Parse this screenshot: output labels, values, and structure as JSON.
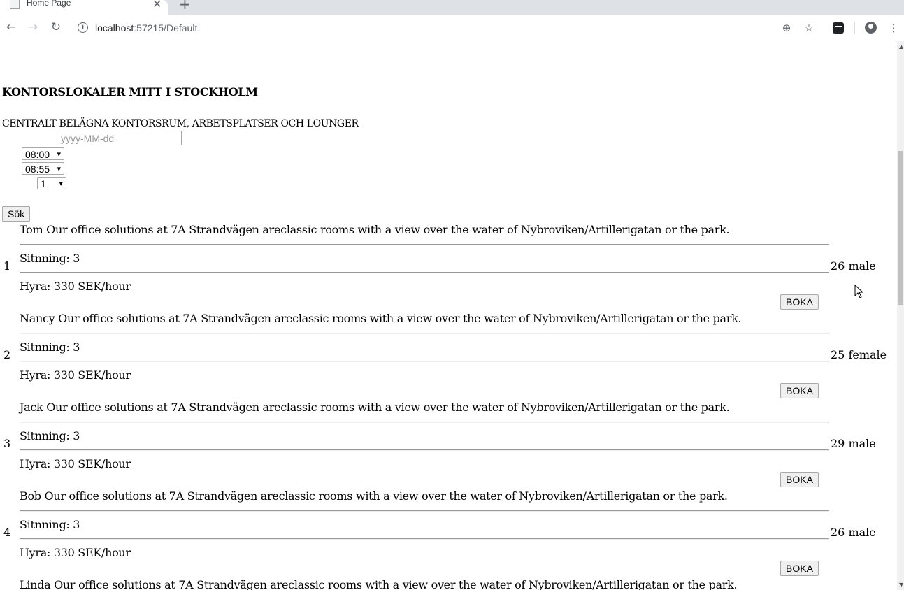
{
  "browser": {
    "tab_title": "Home Page",
    "url_host": "localhost",
    "url_rest": ":57215/Default"
  },
  "page": {
    "heading": "KONTORSLOKALER MITT I STOCKHOLM",
    "subheading": "CENTRALT BELÄGNA KONTORSRUM, ARBETSPLATSER OCH LOUNGER",
    "date_placeholder": "yyyy-MM-dd",
    "start_time": "08:00",
    "end_time": "08:55",
    "count": "1",
    "search_label": "Sök"
  },
  "rows": [
    {
      "num": "1",
      "desc": "Tom Our office solutions at 7A Strandvägen areclassic rooms with a view over the water of Nybroviken/Artillerigatan or the park.",
      "seat": "Sitnning: 3",
      "rent": "Hyra: 330 SEK/hour",
      "meta": "26 male",
      "book": "BOKA"
    },
    {
      "num": "2",
      "desc": "Nancy Our office solutions at 7A Strandvägen areclassic rooms with a view over the water of Nybroviken/Artillerigatan or the park.",
      "seat": "Sitnning: 3",
      "rent": "Hyra: 330 SEK/hour",
      "meta": "25 female",
      "book": "BOKA"
    },
    {
      "num": "3",
      "desc": "Jack Our office solutions at 7A Strandvägen areclassic rooms with a view over the water of Nybroviken/Artillerigatan or the park.",
      "seat": "Sitnning: 3",
      "rent": "Hyra: 330 SEK/hour",
      "meta": "29 male",
      "book": "BOKA"
    },
    {
      "num": "4",
      "desc": "Bob Our office solutions at 7A Strandvägen areclassic rooms with a view over the water of Nybroviken/Artillerigatan or the park.",
      "seat": "Sitnning: 3",
      "rent": "Hyra: 330 SEK/hour",
      "meta": "26 male",
      "book": "BOKA"
    },
    {
      "num": "",
      "desc": "Linda Our office solutions at 7A Strandvägen areclassic rooms with a view over the water of Nybroviken/Artillerigatan or the park.",
      "seat": "",
      "rent": "",
      "meta": "",
      "book": ""
    }
  ]
}
